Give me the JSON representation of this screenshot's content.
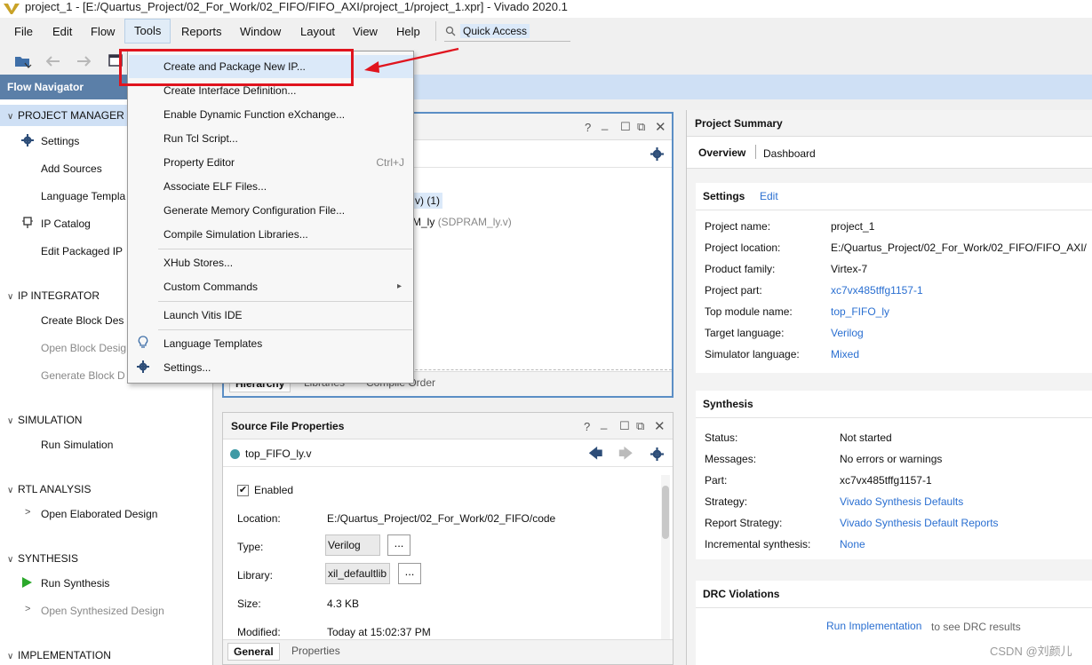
{
  "window": {
    "title": "project_1 - [E:/Quartus_Project/02_For_Work/02_FIFO/FIFO_AXI/project_1/project_1.xpr] - Vivado 2020.1"
  },
  "menubar": {
    "items": [
      "File",
      "Edit",
      "Flow",
      "Tools",
      "Reports",
      "Window",
      "Layout",
      "View",
      "Help"
    ],
    "quick_access": "Quick Access"
  },
  "flow_navigator": {
    "title": "Flow Navigator",
    "project_manager": "PROJECT MANAGER",
    "settings": "Settings",
    "add_sources": "Add Sources",
    "language_templates": "Language Templa",
    "ip_catalog": "IP Catalog",
    "edit_packaged_ip": "Edit Packaged IP",
    "ip_integrator": "IP INTEGRATOR",
    "create_block_design": "Create Block Des",
    "open_block_design": "Open Block Desig",
    "generate_block_design": "Generate Block D",
    "simulation": "SIMULATION",
    "run_simulation": "Run Simulation",
    "rtl_analysis": "RTL ANALYSIS",
    "open_elaborated": "Open Elaborated Design",
    "synthesis": "SYNTHESIS",
    "run_synthesis": "Run Synthesis",
    "open_synthesized": "Open Synthesized Design",
    "implementation": "IMPLEMENTATION"
  },
  "tools_menu": {
    "create_package_ip": "Create and Package New IP...",
    "create_interface": "Create Interface Definition...",
    "enable_dfx": "Enable Dynamic Function eXchange...",
    "run_tcl": "Run Tcl Script...",
    "property_editor": "Property Editor",
    "property_editor_shortcut": "Ctrl+J",
    "associate_elf": "Associate ELF Files...",
    "generate_memory": "Generate Memory Configuration File...",
    "compile_sim_libs": "Compile Simulation Libraries...",
    "xhub_stores": "XHub Stores...",
    "custom_commands": "Custom Commands",
    "launch_vitis": "Launch Vitis IDE",
    "language_templates": "Language Templates",
    "settings": "Settings..."
  },
  "sources": {
    "tree_line1": "v) (1)",
    "tree_line2_name": "M_ly",
    "tree_line2_file": "(SDPRAM_ly.v)",
    "tabs": [
      "Hierarchy",
      "Libraries",
      "Compile Order"
    ]
  },
  "properties": {
    "title": "Source File Properties",
    "file": "top_FIFO_ly.v",
    "enabled_label": "Enabled",
    "location_label": "Location:",
    "location_value": "E:/Quartus_Project/02_For_Work/02_FIFO/code",
    "type_label": "Type:",
    "type_value": "Verilog",
    "library_label": "Library:",
    "library_value": "xil_defaultlib",
    "size_label": "Size:",
    "size_value": "4.3 KB",
    "modified_label": "Modified:",
    "modified_value": "Today at 15:02:37 PM",
    "dots": "...",
    "tabs": [
      "General",
      "Properties"
    ]
  },
  "summary": {
    "title": "Project Summary",
    "tab_overview": "Overview",
    "tab_dashboard": "Dashboard",
    "settings_title": "Settings",
    "settings_edit": "Edit",
    "project_name_k": "Project name:",
    "project_name_v": "project_1",
    "project_location_k": "Project location:",
    "project_location_v": "E:/Quartus_Project/02_For_Work/02_FIFO/FIFO_AXI/",
    "product_family_k": "Product family:",
    "product_family_v": "Virtex-7",
    "project_part_k": "Project part:",
    "project_part_v": "xc7vx485tffg1157-1",
    "top_module_k": "Top module name:",
    "top_module_v": "top_FIFO_ly",
    "target_lang_k": "Target language:",
    "target_lang_v": "Verilog",
    "sim_lang_k": "Simulator language:",
    "sim_lang_v": "Mixed",
    "synthesis_title": "Synthesis",
    "status_k": "Status:",
    "status_v": "Not started",
    "messages_k": "Messages:",
    "messages_v": "No errors or warnings",
    "part_k": "Part:",
    "part_v": "xc7vx485tffg1157-1",
    "strategy_k": "Strategy:",
    "strategy_v": "Vivado Synthesis Defaults",
    "report_strategy_k": "Report Strategy:",
    "report_strategy_v": "Vivado Synthesis Default Reports",
    "incremental_k": "Incremental synthesis:",
    "incremental_v": "None",
    "drc_title": "DRC Violations",
    "run_impl_link": "Run Implementation",
    "run_impl_suffix": "to see DRC results"
  },
  "watermark": "CSDN @刘颜儿",
  "colors": {
    "accent": "#2a6fd1",
    "callout": "#e0141e",
    "nav_header": "#5b7fa8",
    "highlight": "#dbe9f9"
  }
}
